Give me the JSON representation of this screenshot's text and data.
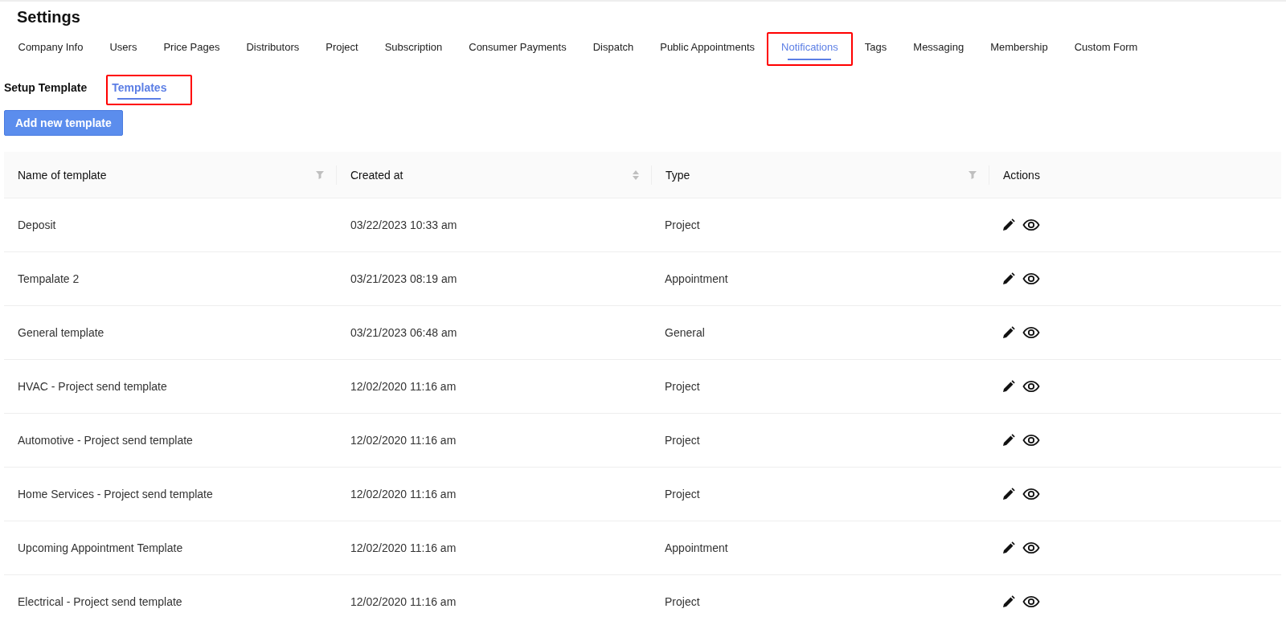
{
  "page": {
    "title": "Settings"
  },
  "tabs": [
    {
      "label": "Company Info",
      "selected": false,
      "highlighted": false
    },
    {
      "label": "Users",
      "selected": false,
      "highlighted": false
    },
    {
      "label": "Price Pages",
      "selected": false,
      "highlighted": false
    },
    {
      "label": "Distributors",
      "selected": false,
      "highlighted": false
    },
    {
      "label": "Project",
      "selected": false,
      "highlighted": false
    },
    {
      "label": "Subscription",
      "selected": false,
      "highlighted": false
    },
    {
      "label": "Consumer Payments",
      "selected": false,
      "highlighted": false
    },
    {
      "label": "Dispatch",
      "selected": false,
      "highlighted": false
    },
    {
      "label": "Public Appointments",
      "selected": false,
      "highlighted": false
    },
    {
      "label": "Notifications",
      "selected": true,
      "highlighted": true
    },
    {
      "label": "Tags",
      "selected": false,
      "highlighted": false
    },
    {
      "label": "Messaging",
      "selected": false,
      "highlighted": false
    },
    {
      "label": "Membership",
      "selected": false,
      "highlighted": false
    },
    {
      "label": "Custom Form",
      "selected": false,
      "highlighted": false
    }
  ],
  "subtabs": [
    {
      "label": "Setup Template",
      "selected": false,
      "highlighted": false
    },
    {
      "label": "Templates",
      "selected": true,
      "highlighted": true
    }
  ],
  "add_button": "Add new template",
  "table": {
    "columns": [
      {
        "label": "Name of template",
        "kind": "filter"
      },
      {
        "label": "Created at",
        "kind": "sort"
      },
      {
        "label": "Type",
        "kind": "filter"
      },
      {
        "label": "Actions",
        "kind": "plain"
      }
    ],
    "rows": [
      {
        "name": "Deposit",
        "created": "03/22/2023 10:33 am",
        "type": "Project"
      },
      {
        "name": "Tempalate 2",
        "created": "03/21/2023 08:19 am",
        "type": "Appointment"
      },
      {
        "name": "General template",
        "created": "03/21/2023 06:48 am",
        "type": "General"
      },
      {
        "name": "HVAC - Project send template",
        "created": "12/02/2020 11:16 am",
        "type": "Project"
      },
      {
        "name": "Automotive - Project send template",
        "created": "12/02/2020 11:16 am",
        "type": "Project"
      },
      {
        "name": "Home Services - Project send template",
        "created": "12/02/2020 11:16 am",
        "type": "Project"
      },
      {
        "name": "Upcoming Appointment Template",
        "created": "12/02/2020 11:16 am",
        "type": "Appointment"
      },
      {
        "name": "Electrical - Project send template",
        "created": "12/02/2020 11:16 am",
        "type": "Project"
      }
    ]
  }
}
